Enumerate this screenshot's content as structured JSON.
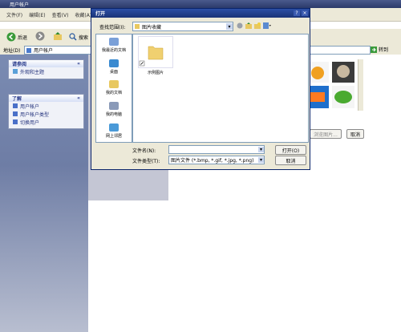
{
  "window": {
    "title": "用户帐户",
    "menu": [
      "文件(F)",
      "编辑(E)",
      "查看(V)",
      "收藏(A)"
    ],
    "toolbar": {
      "back_label": "后退",
      "search_label": "搜索"
    },
    "address_label": "地址(D)",
    "address_value": "用户帐户",
    "go_label": "转到"
  },
  "sidebar": {
    "see_also": {
      "title": "请参阅",
      "items": [
        "外观和主题"
      ]
    },
    "learn": {
      "title": "了解",
      "items": [
        "用户帐户",
        "用户帐户类型",
        "切换用户"
      ]
    }
  },
  "content_buttons": {
    "browse_label": "浏览图片...",
    "cancel_label": "取消"
  },
  "dialog": {
    "title": "打开",
    "help_glyph": "?",
    "close_glyph": "×",
    "look_in_label": "查找范围(I):",
    "look_in_value": "图片收藏",
    "places": [
      "我最近的文档",
      "桌面",
      "我的文档",
      "我的电脑",
      "网上邻居"
    ],
    "files": [
      {
        "name": "示例图片"
      }
    ],
    "file_name_label": "文件名(N):",
    "file_name_value": "",
    "file_type_label": "文件类型(T):",
    "file_type_value": "图片文件 (*.bmp, *.gif, *.jpg, *.png)",
    "open_label": "打开(O)",
    "cancel_label": "取消"
  }
}
